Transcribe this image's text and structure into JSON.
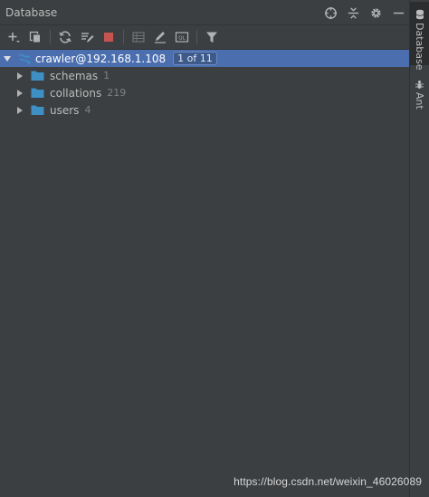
{
  "titlebar": {
    "title": "Database",
    "icons": [
      "crosshair-icon",
      "collapse-icon",
      "gear-icon",
      "minimize-icon"
    ]
  },
  "toolbar": {
    "icons": [
      "add-icon",
      "copy-icon",
      "refresh-icon",
      "edit-schema-icon",
      "stop-icon",
      "table-icon",
      "pencil-icon",
      "console-icon",
      "filter-icon"
    ]
  },
  "tree": {
    "root": {
      "name": "crawler@192.168.1.108",
      "badge": "1 of 11"
    },
    "children": [
      {
        "name": "schemas",
        "count": "1"
      },
      {
        "name": "collations",
        "count": "219"
      },
      {
        "name": "users",
        "count": "4"
      }
    ]
  },
  "side_strip": {
    "database_label": "Database",
    "ant_label": "Ant"
  },
  "watermark": "https://blog.csdn.net/weixin_46026089",
  "colors": {
    "background": "#3c3f41",
    "selection": "#4b6eaf",
    "folder": "#3d8fc4",
    "stop": "#c75450"
  }
}
